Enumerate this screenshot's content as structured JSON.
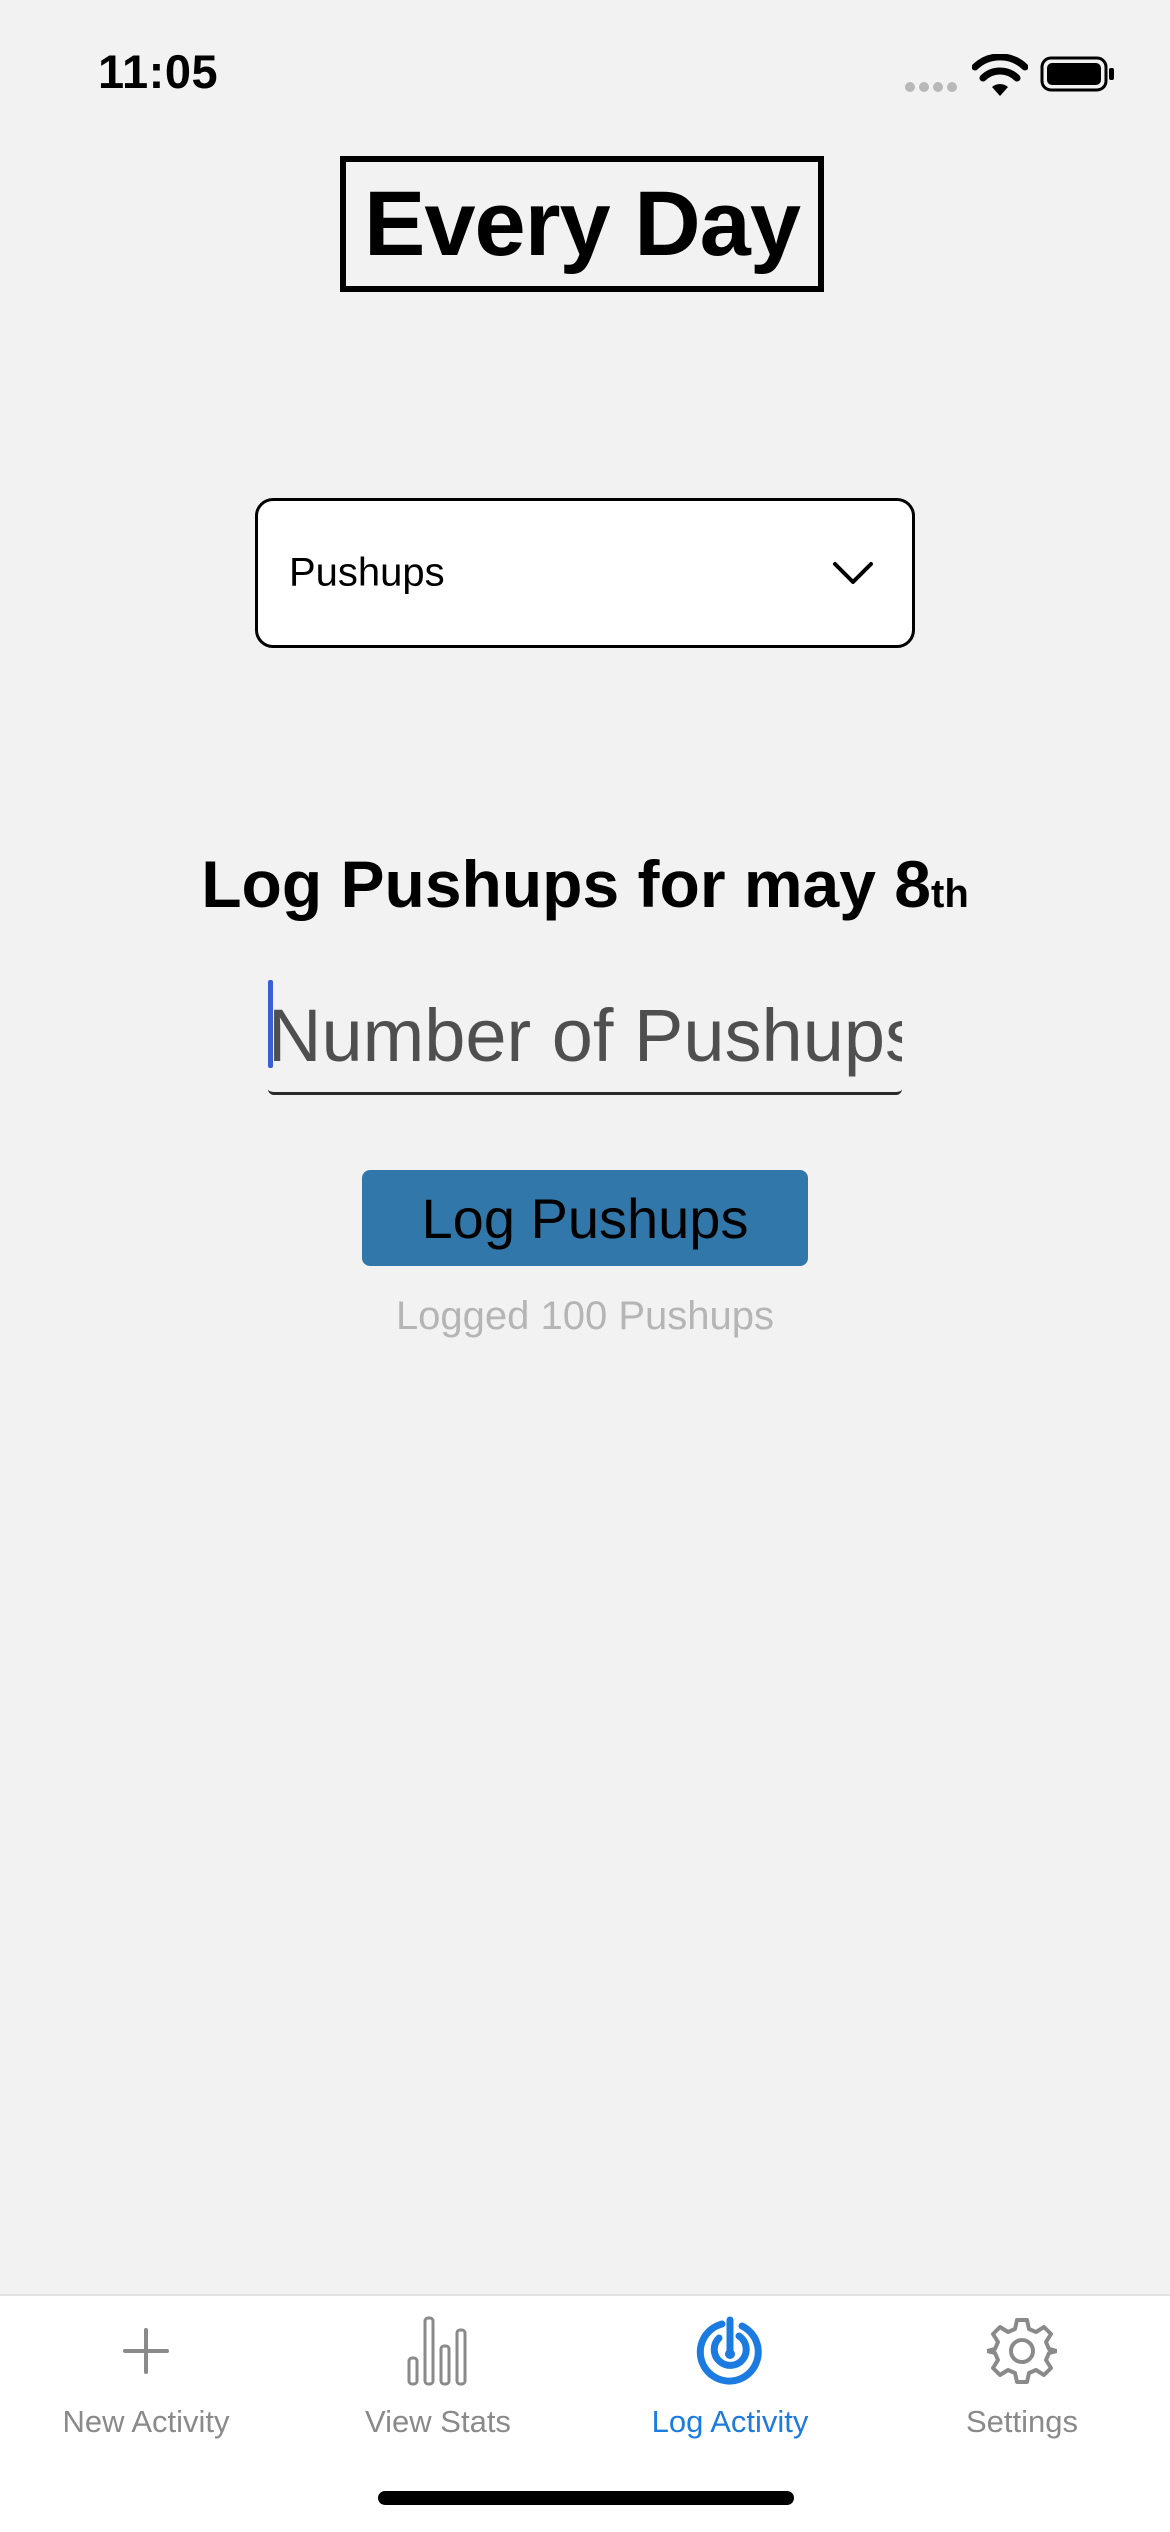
{
  "status_bar": {
    "time": "11:05"
  },
  "header": {
    "title": "Every Day"
  },
  "activity_select": {
    "selected": "Pushups",
    "icon": "chevron-down-icon"
  },
  "log_form": {
    "heading": "Log Pushups for may 8",
    "heading_suffix": "th",
    "input_value": "",
    "input_placeholder": "Number of Pushups",
    "button_label": "Log Pushups",
    "status_text": "Logged 100 Pushups"
  },
  "tab_bar": {
    "active_color": "#1c7be0",
    "inactive_color": "#8a8a8a",
    "tabs": [
      {
        "label": "New Activity",
        "icon": "plus-icon",
        "active": false
      },
      {
        "label": "View Stats",
        "icon": "bar-chart-icon",
        "active": false
      },
      {
        "label": "Log Activity",
        "icon": "log-activity-icon",
        "active": true
      },
      {
        "label": "Settings",
        "icon": "gear-icon",
        "active": false
      }
    ]
  },
  "colors": {
    "background": "#f2f2f2",
    "button": "#3177a9",
    "caret": "#3a5ed8"
  }
}
